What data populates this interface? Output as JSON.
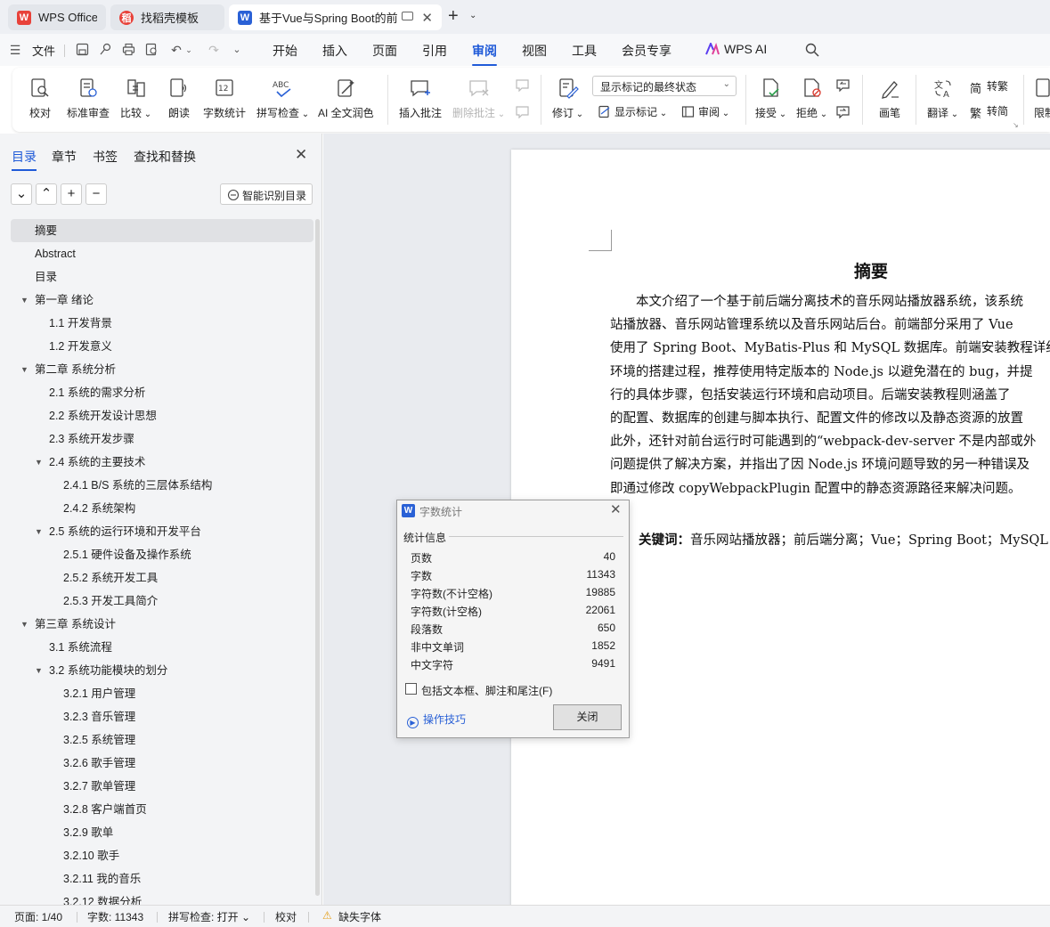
{
  "tabs": [
    {
      "label": "WPS Office",
      "logo": "W",
      "color": "#e8423a"
    },
    {
      "label": "找稻壳模板",
      "logo": "稻",
      "color": "#e8423a"
    },
    {
      "label": "基于Vue与Spring Boot的前后端",
      "logo": "W",
      "color": "#2a61d6"
    }
  ],
  "menu": {
    "file": "文件",
    "items": [
      "开始",
      "插入",
      "页面",
      "引用",
      "审阅",
      "视图",
      "工具",
      "会员专享"
    ],
    "active": "审阅",
    "ai": "WPS AI"
  },
  "ribbon": {
    "proofread": "校对",
    "standard_review": "标准审查",
    "compare": "比较",
    "read_aloud": "朗读",
    "word_count": "字数统计",
    "spell_check": "拼写检查",
    "ai_polish": "AI 全文润色",
    "insert_comment": "插入批注",
    "delete_comment": "删除批注",
    "track_changes": "修订",
    "display_mode": "显示标记的最终状态",
    "show_markup": "显示标记",
    "review": "审阅",
    "accept": "接受",
    "reject": "拒绝",
    "pen": "画笔",
    "translate": "翻译",
    "to_traditional": "转繁",
    "to_simplified": "转简",
    "restrict": "限制"
  },
  "left_panel": {
    "tabs": [
      "目录",
      "章节",
      "书签",
      "查找和替换"
    ],
    "active_tab": "目录",
    "smart_toc": "智能识别目录",
    "toc": [
      {
        "label": "摘要",
        "level": 0,
        "selected": true
      },
      {
        "label": "Abstract",
        "level": 0
      },
      {
        "label": "目录",
        "level": 0
      },
      {
        "label": "第一章  绪论",
        "level": 0,
        "expanded": true
      },
      {
        "label": "1.1 开发背景",
        "level": 1
      },
      {
        "label": "1.2 开发意义",
        "level": 1
      },
      {
        "label": "第二章  系统分析",
        "level": 0,
        "expanded": true
      },
      {
        "label": "2.1 系统的需求分析",
        "level": 1
      },
      {
        "label": "2.2 系统开发设计思想",
        "level": 1
      },
      {
        "label": "2.3 系统开发步骤",
        "level": 1
      },
      {
        "label": "2.4 系统的主要技术",
        "level": 1,
        "expanded": true
      },
      {
        "label": "2.4.1 B/S 系统的三层体系结构",
        "level": 2
      },
      {
        "label": "2.4.2 系统架构",
        "level": 2
      },
      {
        "label": "2.5 系统的运行环境和开发平台",
        "level": 1,
        "expanded": true
      },
      {
        "label": "2.5.1 硬件设备及操作系统",
        "level": 2
      },
      {
        "label": "2.5.2 系统开发工具",
        "level": 2
      },
      {
        "label": "2.5.3 开发工具简介",
        "level": 2
      },
      {
        "label": "第三章  系统设计",
        "level": 0,
        "expanded": true
      },
      {
        "label": "3.1 系统流程",
        "level": 1
      },
      {
        "label": "3.2 系统功能模块的划分",
        "level": 1,
        "expanded": true
      },
      {
        "label": "3.2.1 用户管理",
        "level": 2
      },
      {
        "label": "3.2.3 音乐管理",
        "level": 2
      },
      {
        "label": "3.2.5 系统管理",
        "level": 2
      },
      {
        "label": "3.2.6 歌手管理",
        "level": 2
      },
      {
        "label": "3.2.7 歌单管理",
        "level": 2
      },
      {
        "label": "3.2.8 客户端首页",
        "level": 2
      },
      {
        "label": "3.2.9 歌单",
        "level": 2
      },
      {
        "label": "3.2.10 歌手",
        "level": 2
      },
      {
        "label": "3.2.11 我的音乐",
        "level": 2
      },
      {
        "label": "3.2.12 数据分析",
        "level": 2
      }
    ]
  },
  "document": {
    "title": "摘要",
    "lines": [
      "　　本文介绍了一个基于前后端分离技术的音乐网站播放器系统，该系统",
      "站播放器、音乐网站管理系统以及音乐网站后台。前端部分采用了 Vue",
      "使用了 Spring Boot、MyBatis-Plus 和 MySQL 数据库。前端安装教程详细",
      "环境的搭建过程，推荐使用特定版本的 Node.js 以避免潜在的 bug，并提",
      "行的具体步骤，包括安装运行环境和启动项目。后端安装教程则涵盖了",
      "的配置、数据库的创建与脚本执行、配置文件的修改以及静态资源的放置",
      "此外，还针对前台运行时可能遇到的“webpack-dev-server 不是内部或外",
      "问题提供了解决方案，并指出了因 Node.js 环境问题导致的另一种错误及",
      "即通过修改 copyWebpackPlugin 配置中的静态资源路径来解决问题。"
    ],
    "keywords_label": "关键词：",
    "keywords": "音乐网站播放器；前后端分离；Vue；Spring Boot；MySQL"
  },
  "dialog": {
    "title": "字数统计",
    "section": "统计信息",
    "stats": [
      {
        "label": "页数",
        "value": "40"
      },
      {
        "label": "字数",
        "value": "11343"
      },
      {
        "label": "字符数(不计空格)",
        "value": "19885"
      },
      {
        "label": "字符数(计空格)",
        "value": "22061"
      },
      {
        "label": "段落数",
        "value": "650"
      },
      {
        "label": "非中文单词",
        "value": "1852"
      },
      {
        "label": "中文字符",
        "value": "9491"
      }
    ],
    "checkbox_label": "包括文本框、脚注和尾注(F)",
    "checkbox_checked": false,
    "tips": "操作技巧",
    "close_button": "关闭"
  },
  "status": {
    "page": "页面: 1/40",
    "words": "字数: 11343",
    "spell": "拼写检查: 打开",
    "proof": "校对",
    "missing_font": "缺失字体"
  }
}
